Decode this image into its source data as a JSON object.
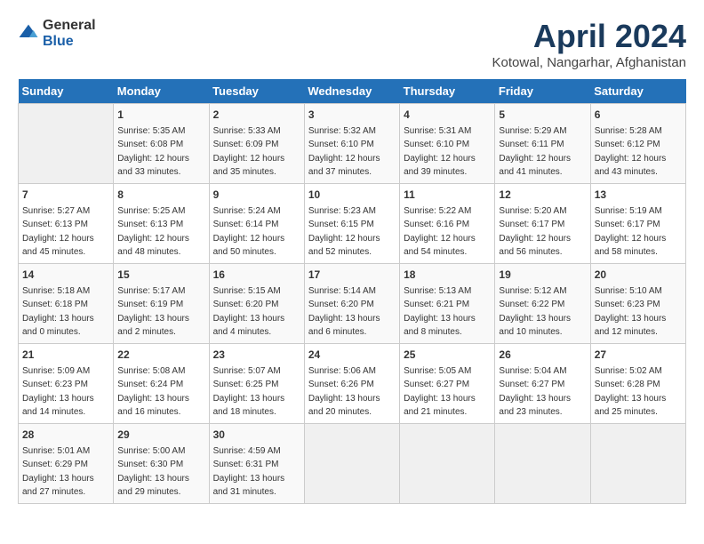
{
  "logo": {
    "general": "General",
    "blue": "Blue"
  },
  "title": "April 2024",
  "subtitle": "Kotowal, Nangarhar, Afghanistan",
  "weekdays": [
    "Sunday",
    "Monday",
    "Tuesday",
    "Wednesday",
    "Thursday",
    "Friday",
    "Saturday"
  ],
  "weeks": [
    [
      {
        "day": "",
        "info": ""
      },
      {
        "day": "1",
        "info": "Sunrise: 5:35 AM\nSunset: 6:08 PM\nDaylight: 12 hours\nand 33 minutes."
      },
      {
        "day": "2",
        "info": "Sunrise: 5:33 AM\nSunset: 6:09 PM\nDaylight: 12 hours\nand 35 minutes."
      },
      {
        "day": "3",
        "info": "Sunrise: 5:32 AM\nSunset: 6:10 PM\nDaylight: 12 hours\nand 37 minutes."
      },
      {
        "day": "4",
        "info": "Sunrise: 5:31 AM\nSunset: 6:10 PM\nDaylight: 12 hours\nand 39 minutes."
      },
      {
        "day": "5",
        "info": "Sunrise: 5:29 AM\nSunset: 6:11 PM\nDaylight: 12 hours\nand 41 minutes."
      },
      {
        "day": "6",
        "info": "Sunrise: 5:28 AM\nSunset: 6:12 PM\nDaylight: 12 hours\nand 43 minutes."
      }
    ],
    [
      {
        "day": "7",
        "info": "Sunrise: 5:27 AM\nSunset: 6:13 PM\nDaylight: 12 hours\nand 45 minutes."
      },
      {
        "day": "8",
        "info": "Sunrise: 5:25 AM\nSunset: 6:13 PM\nDaylight: 12 hours\nand 48 minutes."
      },
      {
        "day": "9",
        "info": "Sunrise: 5:24 AM\nSunset: 6:14 PM\nDaylight: 12 hours\nand 50 minutes."
      },
      {
        "day": "10",
        "info": "Sunrise: 5:23 AM\nSunset: 6:15 PM\nDaylight: 12 hours\nand 52 minutes."
      },
      {
        "day": "11",
        "info": "Sunrise: 5:22 AM\nSunset: 6:16 PM\nDaylight: 12 hours\nand 54 minutes."
      },
      {
        "day": "12",
        "info": "Sunrise: 5:20 AM\nSunset: 6:17 PM\nDaylight: 12 hours\nand 56 minutes."
      },
      {
        "day": "13",
        "info": "Sunrise: 5:19 AM\nSunset: 6:17 PM\nDaylight: 12 hours\nand 58 minutes."
      }
    ],
    [
      {
        "day": "14",
        "info": "Sunrise: 5:18 AM\nSunset: 6:18 PM\nDaylight: 13 hours\nand 0 minutes."
      },
      {
        "day": "15",
        "info": "Sunrise: 5:17 AM\nSunset: 6:19 PM\nDaylight: 13 hours\nand 2 minutes."
      },
      {
        "day": "16",
        "info": "Sunrise: 5:15 AM\nSunset: 6:20 PM\nDaylight: 13 hours\nand 4 minutes."
      },
      {
        "day": "17",
        "info": "Sunrise: 5:14 AM\nSunset: 6:20 PM\nDaylight: 13 hours\nand 6 minutes."
      },
      {
        "day": "18",
        "info": "Sunrise: 5:13 AM\nSunset: 6:21 PM\nDaylight: 13 hours\nand 8 minutes."
      },
      {
        "day": "19",
        "info": "Sunrise: 5:12 AM\nSunset: 6:22 PM\nDaylight: 13 hours\nand 10 minutes."
      },
      {
        "day": "20",
        "info": "Sunrise: 5:10 AM\nSunset: 6:23 PM\nDaylight: 13 hours\nand 12 minutes."
      }
    ],
    [
      {
        "day": "21",
        "info": "Sunrise: 5:09 AM\nSunset: 6:23 PM\nDaylight: 13 hours\nand 14 minutes."
      },
      {
        "day": "22",
        "info": "Sunrise: 5:08 AM\nSunset: 6:24 PM\nDaylight: 13 hours\nand 16 minutes."
      },
      {
        "day": "23",
        "info": "Sunrise: 5:07 AM\nSunset: 6:25 PM\nDaylight: 13 hours\nand 18 minutes."
      },
      {
        "day": "24",
        "info": "Sunrise: 5:06 AM\nSunset: 6:26 PM\nDaylight: 13 hours\nand 20 minutes."
      },
      {
        "day": "25",
        "info": "Sunrise: 5:05 AM\nSunset: 6:27 PM\nDaylight: 13 hours\nand 21 minutes."
      },
      {
        "day": "26",
        "info": "Sunrise: 5:04 AM\nSunset: 6:27 PM\nDaylight: 13 hours\nand 23 minutes."
      },
      {
        "day": "27",
        "info": "Sunrise: 5:02 AM\nSunset: 6:28 PM\nDaylight: 13 hours\nand 25 minutes."
      }
    ],
    [
      {
        "day": "28",
        "info": "Sunrise: 5:01 AM\nSunset: 6:29 PM\nDaylight: 13 hours\nand 27 minutes."
      },
      {
        "day": "29",
        "info": "Sunrise: 5:00 AM\nSunset: 6:30 PM\nDaylight: 13 hours\nand 29 minutes."
      },
      {
        "day": "30",
        "info": "Sunrise: 4:59 AM\nSunset: 6:31 PM\nDaylight: 13 hours\nand 31 minutes."
      },
      {
        "day": "",
        "info": ""
      },
      {
        "day": "",
        "info": ""
      },
      {
        "day": "",
        "info": ""
      },
      {
        "day": "",
        "info": ""
      }
    ]
  ]
}
